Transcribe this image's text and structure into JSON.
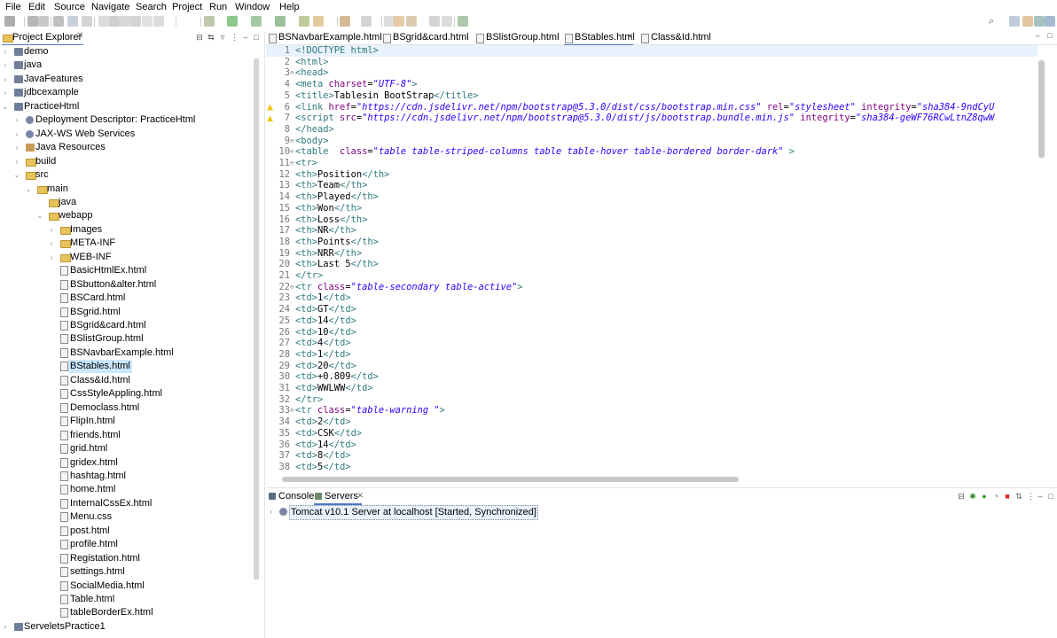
{
  "menubar": [
    "File",
    "Edit",
    "Source",
    "Navigate",
    "Search",
    "Project",
    "Run",
    "Window",
    "Help"
  ],
  "project_explorer": {
    "title": "Project Explorer",
    "items": [
      {
        "label": "demo",
        "depth": 0,
        "icon": "project-icon",
        "expanded": false
      },
      {
        "label": "java",
        "depth": 0,
        "icon": "project-icon",
        "expanded": false
      },
      {
        "label": "JavaFeatures",
        "depth": 0,
        "icon": "project-icon",
        "expanded": false
      },
      {
        "label": "jdbcexample",
        "depth": 0,
        "icon": "project-icon",
        "expanded": false
      },
      {
        "label": "PracticeHtml",
        "depth": 0,
        "icon": "project-icon",
        "expanded": true
      },
      {
        "label": "Deployment Descriptor: PracticeHtml",
        "depth": 1,
        "icon": "gear-icon",
        "expanded": false
      },
      {
        "label": "JAX-WS Web Services",
        "depth": 1,
        "icon": "gear-icon",
        "expanded": false
      },
      {
        "label": "Java Resources",
        "depth": 1,
        "icon": "jar-icon",
        "expanded": false
      },
      {
        "label": "build",
        "depth": 1,
        "icon": "folder-icon",
        "expanded": false
      },
      {
        "label": "src",
        "depth": 1,
        "icon": "folder-icon",
        "expanded": true
      },
      {
        "label": "main",
        "depth": 2,
        "icon": "folder-icon",
        "expanded": true
      },
      {
        "label": "java",
        "depth": 3,
        "icon": "folder-icon",
        "expanded": null
      },
      {
        "label": "webapp",
        "depth": 3,
        "icon": "folder-icon",
        "expanded": true
      },
      {
        "label": "Images",
        "depth": 4,
        "icon": "folder-icon",
        "expanded": false
      },
      {
        "label": "META-INF",
        "depth": 4,
        "icon": "folder-icon",
        "expanded": false
      },
      {
        "label": "WEB-INF",
        "depth": 4,
        "icon": "folder-icon",
        "expanded": false
      },
      {
        "label": "BasicHtmlEx.html",
        "depth": 4,
        "icon": "file-icon",
        "expanded": null
      },
      {
        "label": "BSbutton&alter.html",
        "depth": 4,
        "icon": "file-icon",
        "expanded": null
      },
      {
        "label": "BSCard.html",
        "depth": 4,
        "icon": "file-icon",
        "expanded": null
      },
      {
        "label": "BSgrid.html",
        "depth": 4,
        "icon": "file-icon",
        "expanded": null
      },
      {
        "label": "BSgrid&card.html",
        "depth": 4,
        "icon": "file-icon",
        "expanded": null
      },
      {
        "label": "BSlistGroup.html",
        "depth": 4,
        "icon": "file-icon",
        "expanded": null
      },
      {
        "label": "BSNavbarExample.html",
        "depth": 4,
        "icon": "file-icon",
        "expanded": null
      },
      {
        "label": "BStables.html",
        "depth": 4,
        "icon": "file-icon",
        "expanded": null,
        "selected": true
      },
      {
        "label": "Class&Id.html",
        "depth": 4,
        "icon": "file-icon",
        "expanded": null
      },
      {
        "label": "CssStyleAppling.html",
        "depth": 4,
        "icon": "file-icon",
        "expanded": null
      },
      {
        "label": "Democlass.html",
        "depth": 4,
        "icon": "file-icon",
        "expanded": null
      },
      {
        "label": "FlipIn.html",
        "depth": 4,
        "icon": "file-icon",
        "expanded": null
      },
      {
        "label": "friends.html",
        "depth": 4,
        "icon": "file-icon",
        "expanded": null
      },
      {
        "label": "grid.html",
        "depth": 4,
        "icon": "file-icon",
        "expanded": null
      },
      {
        "label": "gridex.html",
        "depth": 4,
        "icon": "file-icon",
        "expanded": null
      },
      {
        "label": "hashtag.html",
        "depth": 4,
        "icon": "file-icon",
        "expanded": null
      },
      {
        "label": "home.html",
        "depth": 4,
        "icon": "file-icon",
        "expanded": null
      },
      {
        "label": "InternalCssEx.html",
        "depth": 4,
        "icon": "file-icon",
        "expanded": null
      },
      {
        "label": "Menu.css",
        "depth": 4,
        "icon": "file-icon",
        "expanded": null
      },
      {
        "label": "post.html",
        "depth": 4,
        "icon": "file-icon",
        "expanded": null
      },
      {
        "label": "profile.html",
        "depth": 4,
        "icon": "file-icon",
        "expanded": null
      },
      {
        "label": "Registation.html",
        "depth": 4,
        "icon": "file-icon",
        "expanded": null
      },
      {
        "label": "settings.html",
        "depth": 4,
        "icon": "file-icon",
        "expanded": null
      },
      {
        "label": "SocialMedia.html",
        "depth": 4,
        "icon": "file-icon",
        "expanded": null
      },
      {
        "label": "Table.html",
        "depth": 4,
        "icon": "file-icon",
        "expanded": null
      },
      {
        "label": "tableBorderEx.html",
        "depth": 4,
        "icon": "file-icon",
        "expanded": null
      },
      {
        "label": "ServeletsPractice1",
        "depth": 0,
        "icon": "project-icon",
        "expanded": false
      }
    ]
  },
  "editor": {
    "tabs": [
      {
        "label": "BSNavbarExample.html",
        "active": false
      },
      {
        "label": "BSgrid&card.html",
        "active": false
      },
      {
        "label": "BSlistGroup.html",
        "active": false
      },
      {
        "label": "BStables.html",
        "active": true
      },
      {
        "label": "Class&Id.html",
        "active": false
      }
    ],
    "lines": [
      {
        "n": "1",
        "fold": "",
        "warn": false,
        "cur": true,
        "parts": [
          [
            "tag",
            "<!DOCTYPE html>"
          ]
        ]
      },
      {
        "n": "2",
        "fold": "",
        "warn": false,
        "parts": [
          [
            "tag",
            "<html>"
          ]
        ]
      },
      {
        "n": "3",
        "fold": "⊖",
        "warn": false,
        "parts": [
          [
            "tag",
            "<head>"
          ]
        ]
      },
      {
        "n": "4",
        "fold": "",
        "warn": false,
        "parts": [
          [
            "tag",
            "<meta "
          ],
          [
            "attr",
            "charset"
          ],
          [
            "txt",
            "="
          ],
          [
            "str",
            "\"UTF-8\""
          ],
          [
            "tag",
            ">"
          ]
        ]
      },
      {
        "n": "5",
        "fold": "",
        "warn": false,
        "parts": [
          [
            "tag",
            "<title>"
          ],
          [
            "txt",
            "Tablesin BootStrap"
          ],
          [
            "tag",
            "</title>"
          ]
        ]
      },
      {
        "n": "6",
        "fold": "",
        "warn": true,
        "parts": [
          [
            "tag",
            "<link "
          ],
          [
            "attr",
            "href"
          ],
          [
            "txt",
            "="
          ],
          [
            "str",
            "\"https://cdn.jsdelivr.net/npm/bootstrap@5.3.0/dist/css/bootstrap.min.css\""
          ],
          [
            "txt",
            " "
          ],
          [
            "attr",
            "rel"
          ],
          [
            "txt",
            "="
          ],
          [
            "str",
            "\"stylesheet\""
          ],
          [
            "txt",
            " "
          ],
          [
            "attr",
            "integrity"
          ],
          [
            "txt",
            "="
          ],
          [
            "str",
            "\"sha384-9ndCyU"
          ]
        ]
      },
      {
        "n": "7",
        "fold": "",
        "warn": true,
        "parts": [
          [
            "tag",
            "<script "
          ],
          [
            "attr",
            "src"
          ],
          [
            "txt",
            "="
          ],
          [
            "str",
            "\"https://cdn.jsdelivr.net/npm/bootstrap@5.3.0/dist/js/bootstrap.bundle.min.js\""
          ],
          [
            "txt",
            " "
          ],
          [
            "attr",
            "integrity"
          ],
          [
            "txt",
            "="
          ],
          [
            "str",
            "\"sha384-geWF76RCwLtnZ8qwW"
          ]
        ]
      },
      {
        "n": "8",
        "fold": "",
        "warn": false,
        "parts": [
          [
            "tag",
            "</head>"
          ]
        ]
      },
      {
        "n": "9",
        "fold": "⊖",
        "warn": false,
        "parts": [
          [
            "tag",
            "<body>"
          ]
        ]
      },
      {
        "n": "10",
        "fold": "⊖",
        "warn": false,
        "parts": [
          [
            "tag",
            "<table  "
          ],
          [
            "attr",
            "class"
          ],
          [
            "txt",
            "="
          ],
          [
            "str",
            "\"table table-striped-columns table table-hover table-bordered border-dark\""
          ],
          [
            "tag",
            " >"
          ]
        ]
      },
      {
        "n": "11",
        "fold": "⊖",
        "warn": false,
        "parts": [
          [
            "tag",
            "<tr>"
          ]
        ]
      },
      {
        "n": "12",
        "fold": "",
        "warn": false,
        "parts": [
          [
            "tag",
            "<th>"
          ],
          [
            "txt",
            "Position"
          ],
          [
            "tag",
            "</th>"
          ]
        ]
      },
      {
        "n": "13",
        "fold": "",
        "warn": false,
        "parts": [
          [
            "tag",
            "<th>"
          ],
          [
            "txt",
            "Team"
          ],
          [
            "tag",
            "</th>"
          ]
        ]
      },
      {
        "n": "14",
        "fold": "",
        "warn": false,
        "parts": [
          [
            "tag",
            "<th>"
          ],
          [
            "txt",
            "Played"
          ],
          [
            "tag",
            "</th>"
          ]
        ]
      },
      {
        "n": "15",
        "fold": "",
        "warn": false,
        "parts": [
          [
            "tag",
            "<th>"
          ],
          [
            "txt",
            "Won"
          ],
          [
            "tag",
            "</th>"
          ]
        ]
      },
      {
        "n": "16",
        "fold": "",
        "warn": false,
        "parts": [
          [
            "tag",
            "<th>"
          ],
          [
            "txt",
            "Loss"
          ],
          [
            "tag",
            "</th>"
          ]
        ]
      },
      {
        "n": "17",
        "fold": "",
        "warn": false,
        "parts": [
          [
            "tag",
            "<th>"
          ],
          [
            "txt",
            "NR"
          ],
          [
            "tag",
            "</th>"
          ]
        ]
      },
      {
        "n": "18",
        "fold": "",
        "warn": false,
        "parts": [
          [
            "tag",
            "<th>"
          ],
          [
            "txt",
            "Points"
          ],
          [
            "tag",
            "</th>"
          ]
        ]
      },
      {
        "n": "19",
        "fold": "",
        "warn": false,
        "parts": [
          [
            "tag",
            "<th>"
          ],
          [
            "txt",
            "NRR"
          ],
          [
            "tag",
            "</th>"
          ]
        ]
      },
      {
        "n": "20",
        "fold": "",
        "warn": false,
        "parts": [
          [
            "tag",
            "<th>"
          ],
          [
            "txt",
            "Last 5"
          ],
          [
            "tag",
            "</th>"
          ]
        ]
      },
      {
        "n": "21",
        "fold": "",
        "warn": false,
        "parts": [
          [
            "tag",
            "</tr>"
          ]
        ]
      },
      {
        "n": "22",
        "fold": "⊖",
        "warn": false,
        "parts": [
          [
            "tag",
            "<tr "
          ],
          [
            "attr",
            "class"
          ],
          [
            "txt",
            "="
          ],
          [
            "str",
            "\"table-secondary table-active\""
          ],
          [
            "tag",
            ">"
          ]
        ]
      },
      {
        "n": "23",
        "fold": "",
        "warn": false,
        "parts": [
          [
            "tag",
            "<td>"
          ],
          [
            "txt",
            "1"
          ],
          [
            "tag",
            "</td>"
          ]
        ]
      },
      {
        "n": "24",
        "fold": "",
        "warn": false,
        "parts": [
          [
            "tag",
            "<td>"
          ],
          [
            "txt",
            "GT"
          ],
          [
            "tag",
            "</td>"
          ]
        ]
      },
      {
        "n": "25",
        "fold": "",
        "warn": false,
        "parts": [
          [
            "tag",
            "<td>"
          ],
          [
            "txt",
            "14"
          ],
          [
            "tag",
            "</td>"
          ]
        ]
      },
      {
        "n": "26",
        "fold": "",
        "warn": false,
        "parts": [
          [
            "tag",
            "<td>"
          ],
          [
            "txt",
            "10"
          ],
          [
            "tag",
            "</td>"
          ]
        ]
      },
      {
        "n": "27",
        "fold": "",
        "warn": false,
        "parts": [
          [
            "tag",
            "<td>"
          ],
          [
            "txt",
            "4"
          ],
          [
            "tag",
            "</td>"
          ]
        ]
      },
      {
        "n": "28",
        "fold": "",
        "warn": false,
        "parts": [
          [
            "tag",
            "<td>"
          ],
          [
            "txt",
            "1"
          ],
          [
            "tag",
            "</td>"
          ]
        ]
      },
      {
        "n": "29",
        "fold": "",
        "warn": false,
        "parts": [
          [
            "tag",
            "<td>"
          ],
          [
            "txt",
            "20"
          ],
          [
            "tag",
            "</td>"
          ]
        ]
      },
      {
        "n": "30",
        "fold": "",
        "warn": false,
        "parts": [
          [
            "tag",
            "<td>"
          ],
          [
            "txt",
            "+0.809"
          ],
          [
            "tag",
            "</td>"
          ]
        ]
      },
      {
        "n": "31",
        "fold": "",
        "warn": false,
        "parts": [
          [
            "tag",
            "<td>"
          ],
          [
            "txt",
            "WWLWW"
          ],
          [
            "tag",
            "</td>"
          ]
        ]
      },
      {
        "n": "32",
        "fold": "",
        "warn": false,
        "parts": [
          [
            "tag",
            "</tr>"
          ]
        ]
      },
      {
        "n": "33",
        "fold": "⊖",
        "warn": false,
        "parts": [
          [
            "tag",
            "<tr "
          ],
          [
            "attr",
            "class"
          ],
          [
            "txt",
            "="
          ],
          [
            "str",
            "\"table-warning \""
          ],
          [
            "tag",
            ">"
          ]
        ]
      },
      {
        "n": "34",
        "fold": "",
        "warn": false,
        "parts": [
          [
            "tag",
            "<td>"
          ],
          [
            "txt",
            "2"
          ],
          [
            "tag",
            "</td>"
          ]
        ]
      },
      {
        "n": "35",
        "fold": "",
        "warn": false,
        "parts": [
          [
            "tag",
            "<td>"
          ],
          [
            "txt",
            "CSK"
          ],
          [
            "tag",
            "</td>"
          ]
        ]
      },
      {
        "n": "36",
        "fold": "",
        "warn": false,
        "parts": [
          [
            "tag",
            "<td>"
          ],
          [
            "txt",
            "14"
          ],
          [
            "tag",
            "</td>"
          ]
        ]
      },
      {
        "n": "37",
        "fold": "",
        "warn": false,
        "parts": [
          [
            "tag",
            "<td>"
          ],
          [
            "txt",
            "8"
          ],
          [
            "tag",
            "</td>"
          ]
        ]
      },
      {
        "n": "38",
        "fold": "",
        "warn": false,
        "parts": [
          [
            "tag",
            "<td>"
          ],
          [
            "txt",
            "5"
          ],
          [
            "tag",
            "</td>"
          ]
        ]
      }
    ]
  },
  "bottom_panel": {
    "tabs": [
      {
        "label": "Console",
        "active": false,
        "icon": "console-icon"
      },
      {
        "label": "Servers",
        "active": true,
        "icon": "servers-icon"
      }
    ],
    "server_entry": "Tomcat v10.1 Server at localhost  [Started, Synchronized]"
  },
  "colors": {
    "accent": "#4a78c4",
    "selection": "#cce8ff",
    "tag": "#2f7a7d",
    "attribute": "#7f007f",
    "string": "#2a00ff"
  }
}
